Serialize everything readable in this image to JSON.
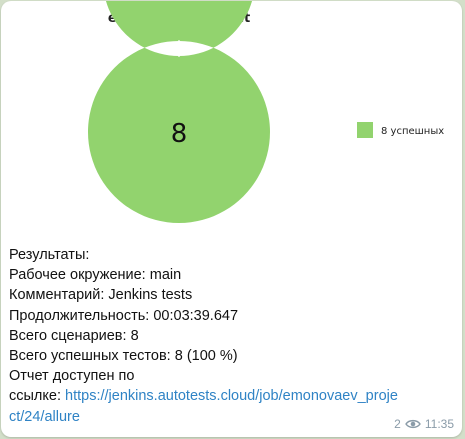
{
  "chart_data": {
    "type": "pie",
    "title": "emonovaev_project",
    "center_label": "8",
    "slices": [
      {
        "name": "8 успешных",
        "value": 8,
        "color": "#92d36e"
      }
    ],
    "legend_position": "right"
  },
  "message": {
    "lines": [
      {
        "label": "Результаты:",
        "value": ""
      },
      {
        "label": "Рабочее окружение:",
        "value": "main"
      },
      {
        "label": "Комментарий:",
        "value": "Jenkins tests"
      },
      {
        "label": "Продолжительность:",
        "value": "00:03:39.647"
      },
      {
        "label": "Всего сценариев:",
        "value": "8"
      },
      {
        "label": "Всего успешных тестов:",
        "value": "8 (100 %)"
      }
    ],
    "link_intro_1": "Отчет доступен по",
    "link_intro_2": "ссылке:",
    "link_part_1": "https://jenkins.autotests.cloud/job/emonovaev_proje",
    "link_part_2": "ct/24/allure"
  },
  "meta": {
    "views": "2",
    "time": "11:35",
    "eye_icon": "eye-icon"
  },
  "colors": {
    "success": "#92d36e",
    "link": "#2f83c5",
    "meta": "#8a9ba8"
  }
}
